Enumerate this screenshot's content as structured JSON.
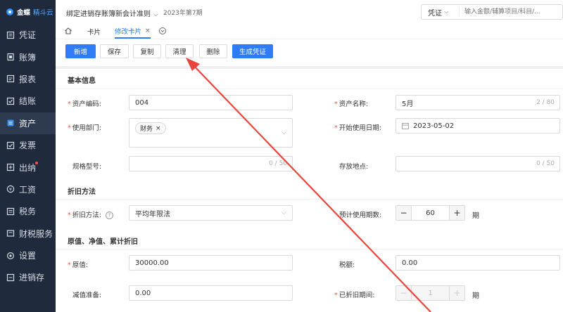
{
  "brand": {
    "name": "金蝶",
    "sub": "精斗云"
  },
  "sidebar": {
    "items": [
      {
        "label": "凭证",
        "icon": "voucher-icon"
      },
      {
        "label": "账簿",
        "icon": "ledger-icon"
      },
      {
        "label": "报表",
        "icon": "report-icon"
      },
      {
        "label": "结账",
        "icon": "closing-icon"
      },
      {
        "label": "资产",
        "icon": "asset-icon",
        "active": true
      },
      {
        "label": "发票",
        "icon": "invoice-icon"
      },
      {
        "label": "出纳",
        "icon": "cashier-icon",
        "badge": true
      },
      {
        "label": "工资",
        "icon": "salary-icon"
      },
      {
        "label": "税务",
        "icon": "tax-icon"
      },
      {
        "label": "财税服务",
        "icon": "service-icon"
      },
      {
        "label": "设置",
        "icon": "settings-icon"
      },
      {
        "label": "进销存",
        "icon": "inventory-icon"
      }
    ]
  },
  "header": {
    "company": "绑定进销存账簿新会计准则",
    "period": "2023年第7期",
    "search_type": "凭证",
    "search_placeholder": "输入金额/辅算项目/科目/..."
  },
  "tabs": [
    {
      "label": "卡片"
    },
    {
      "label": "修改卡片",
      "active": true,
      "close": "×"
    }
  ],
  "toolbar": {
    "new": "新增",
    "save": "保存",
    "copy": "复制",
    "clear": "清理",
    "delete": "删除",
    "gen_voucher": "生成凭证"
  },
  "form": {
    "sections": {
      "basic": "基本信息",
      "depreciation": "折旧方法",
      "values": "原值、净值、累计折旧"
    },
    "fields": {
      "asset_code": {
        "label": "资产编码:",
        "value": "004"
      },
      "asset_name": {
        "label": "资产名称:",
        "value": "5月",
        "counter": "2 / 80"
      },
      "department": {
        "label": "使用部门:",
        "tag": "财务",
        "tag_close": "×"
      },
      "start_date": {
        "label": "开始使用日期:",
        "value": "2023-05-02"
      },
      "spec": {
        "label": "规格型号:",
        "counter": "0 / 50"
      },
      "location": {
        "label": "存放地点:",
        "counter": "0 / 50"
      },
      "dep_method": {
        "label": "折旧方法:",
        "value": "平均年限法",
        "help": "?"
      },
      "periods": {
        "label": "预计使用期数:",
        "value": "60",
        "minus": "−",
        "plus": "+",
        "unit": "期"
      },
      "original_value": {
        "label": "原值:",
        "value": "30000.00"
      },
      "tax": {
        "label": "税额:",
        "value": "0.00"
      },
      "impairment": {
        "label": "减值准备:",
        "value": "0.00"
      },
      "dep_periods": {
        "label": "已折旧期间:",
        "value": "1",
        "minus": "−",
        "plus": "+",
        "unit": "期"
      }
    }
  },
  "colors": {
    "accent": "#2f7cf6",
    "sidebar": "#1f2a3c",
    "required": "#ff4d4f",
    "annotation": "#e8453c"
  }
}
